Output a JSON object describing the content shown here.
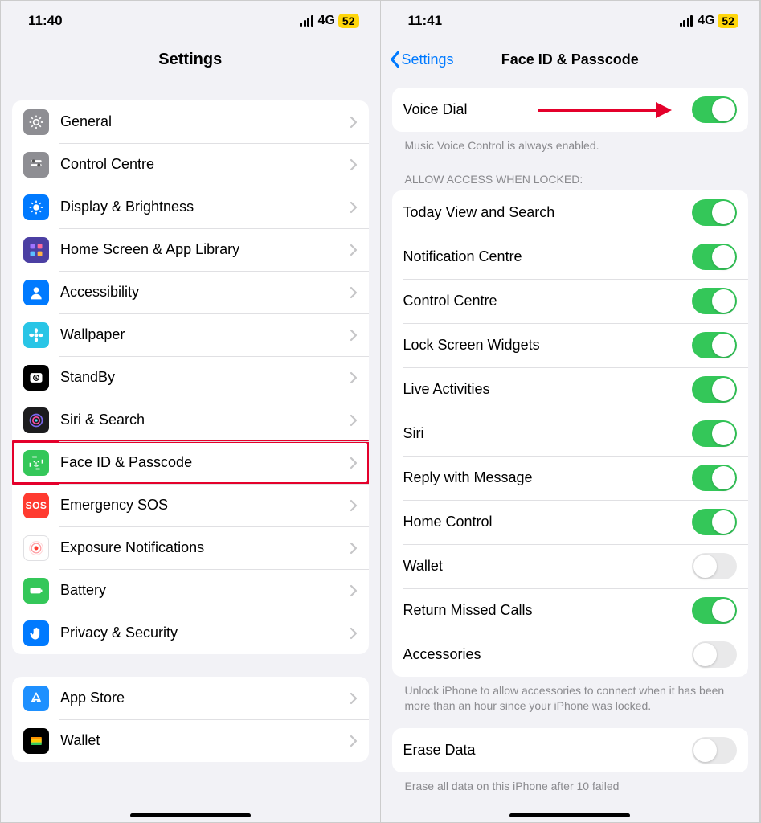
{
  "left": {
    "status": {
      "time": "11:40",
      "network": "4G",
      "battery": "52"
    },
    "title": "Settings",
    "groups": [
      {
        "items": [
          {
            "id": "general",
            "label": "General",
            "icon_bg": "#8e8e93",
            "glyph": "gear"
          },
          {
            "id": "control-centre",
            "label": "Control Centre",
            "icon_bg": "#8e8e93",
            "glyph": "sliders"
          },
          {
            "id": "display",
            "label": "Display & Brightness",
            "icon_bg": "#007aff",
            "glyph": "sun"
          },
          {
            "id": "home-screen",
            "label": "Home Screen & App Library",
            "icon_bg": "#4b3fa3",
            "glyph": "grid"
          },
          {
            "id": "accessibility",
            "label": "Accessibility",
            "icon_bg": "#007aff",
            "glyph": "person"
          },
          {
            "id": "wallpaper",
            "label": "Wallpaper",
            "icon_bg": "#29c5e6",
            "glyph": "flower"
          },
          {
            "id": "standby",
            "label": "StandBy",
            "icon_bg": "#000000",
            "glyph": "clock"
          },
          {
            "id": "siri",
            "label": "Siri & Search",
            "icon_bg": "#1c1c1e",
            "glyph": "siri"
          },
          {
            "id": "faceid",
            "label": "Face ID & Passcode",
            "icon_bg": "#34c759",
            "glyph": "faceid",
            "highlighted": true
          },
          {
            "id": "sos",
            "label": "Emergency SOS",
            "icon_bg": "#ff3b30",
            "glyph": "sos"
          },
          {
            "id": "exposure",
            "label": "Exposure Notifications",
            "icon_bg": "#ffffff",
            "glyph": "exposure"
          },
          {
            "id": "battery",
            "label": "Battery",
            "icon_bg": "#34c759",
            "glyph": "battery"
          },
          {
            "id": "privacy",
            "label": "Privacy & Security",
            "icon_bg": "#007aff",
            "glyph": "hand"
          }
        ]
      },
      {
        "items": [
          {
            "id": "appstore",
            "label": "App Store",
            "icon_bg": "#1e90ff",
            "glyph": "appstore"
          },
          {
            "id": "wallet",
            "label": "Wallet",
            "icon_bg": "#000000",
            "glyph": "wallet"
          }
        ]
      }
    ]
  },
  "right": {
    "status": {
      "time": "11:41",
      "network": "4G",
      "battery": "52"
    },
    "back_label": "Settings",
    "title": "Face ID & Passcode",
    "voice_dial": {
      "label": "Voice Dial",
      "on": true
    },
    "voice_dial_footer": "Music Voice Control is always enabled.",
    "allow_header": "ALLOW ACCESS WHEN LOCKED:",
    "allow_items": [
      {
        "id": "today",
        "label": "Today View and Search",
        "on": true
      },
      {
        "id": "notif",
        "label": "Notification Centre",
        "on": true
      },
      {
        "id": "control",
        "label": "Control Centre",
        "on": true
      },
      {
        "id": "widgets",
        "label": "Lock Screen Widgets",
        "on": true
      },
      {
        "id": "live",
        "label": "Live Activities",
        "on": true
      },
      {
        "id": "siri",
        "label": "Siri",
        "on": true
      },
      {
        "id": "reply",
        "label": "Reply with Message",
        "on": true
      },
      {
        "id": "home",
        "label": "Home Control",
        "on": true
      },
      {
        "id": "wallet",
        "label": "Wallet",
        "on": false
      },
      {
        "id": "missed",
        "label": "Return Missed Calls",
        "on": true
      },
      {
        "id": "acc",
        "label": "Accessories",
        "on": false
      }
    ],
    "accessories_footer": "Unlock iPhone to allow accessories to connect when it has been more than an hour since your iPhone was locked.",
    "erase": {
      "label": "Erase Data",
      "on": false
    },
    "erase_footer": "Erase all data on this iPhone after 10 failed"
  }
}
